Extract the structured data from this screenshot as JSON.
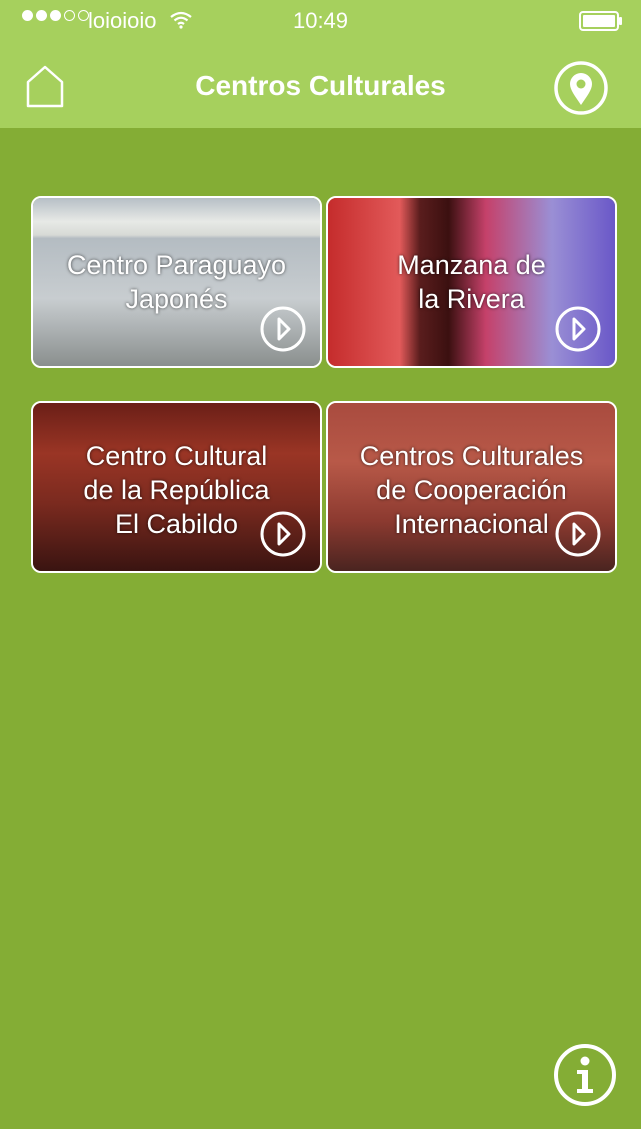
{
  "status_bar": {
    "carrier": "loioioio",
    "time": "10:49",
    "signal_full": 3,
    "signal_empty": 2
  },
  "nav": {
    "title": "Centros Culturales",
    "home_icon": "home-icon",
    "map_icon": "map-pin-icon"
  },
  "tiles": [
    {
      "label": "Centro Paraguayo\nJaponés"
    },
    {
      "label": "Manzana de\nla Rivera"
    },
    {
      "label": "Centro Cultural\nde la República\nEl Cabildo"
    },
    {
      "label": "Centros Culturales\nde Cooperación\nInternacional"
    }
  ],
  "colors": {
    "background": "#84ad35",
    "header": "#a6d05d",
    "foreground": "#ffffff"
  },
  "info_icon": "info-icon"
}
